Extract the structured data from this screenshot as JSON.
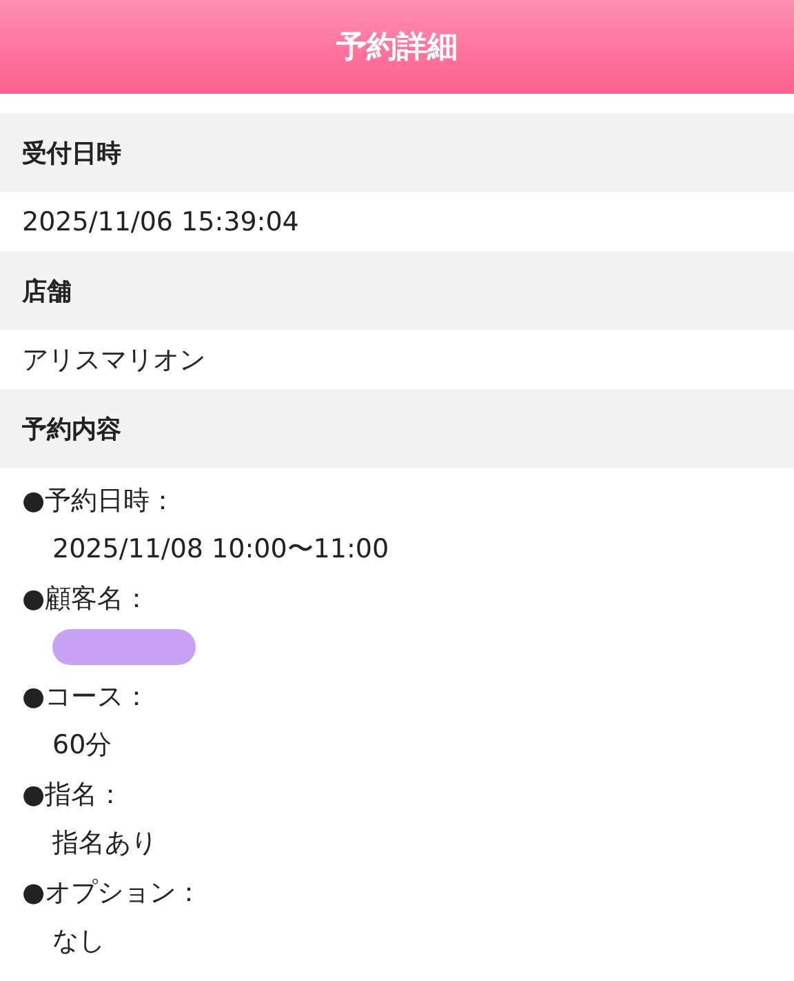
{
  "header": {
    "title": "予約詳細"
  },
  "sections": [
    {
      "heading": "受付日時",
      "kind": "text",
      "value": "2025/11/06 15:39:04"
    },
    {
      "heading": "店舗",
      "kind": "text",
      "value": "アリスマリオン"
    },
    {
      "heading": "予約内容",
      "kind": "list",
      "items": [
        {
          "label": "●予約日時：",
          "value": "2025/11/08 10:00〜11:00",
          "redacted": false
        },
        {
          "label": "●顧客名：",
          "redacted": true
        },
        {
          "label": "●コース：",
          "value": "60分",
          "redacted": false
        },
        {
          "label": "●指名：",
          "value": "指名あり",
          "redacted": false
        },
        {
          "label": "●オプション：",
          "value": "なし",
          "redacted": false
        }
      ]
    }
  ]
}
